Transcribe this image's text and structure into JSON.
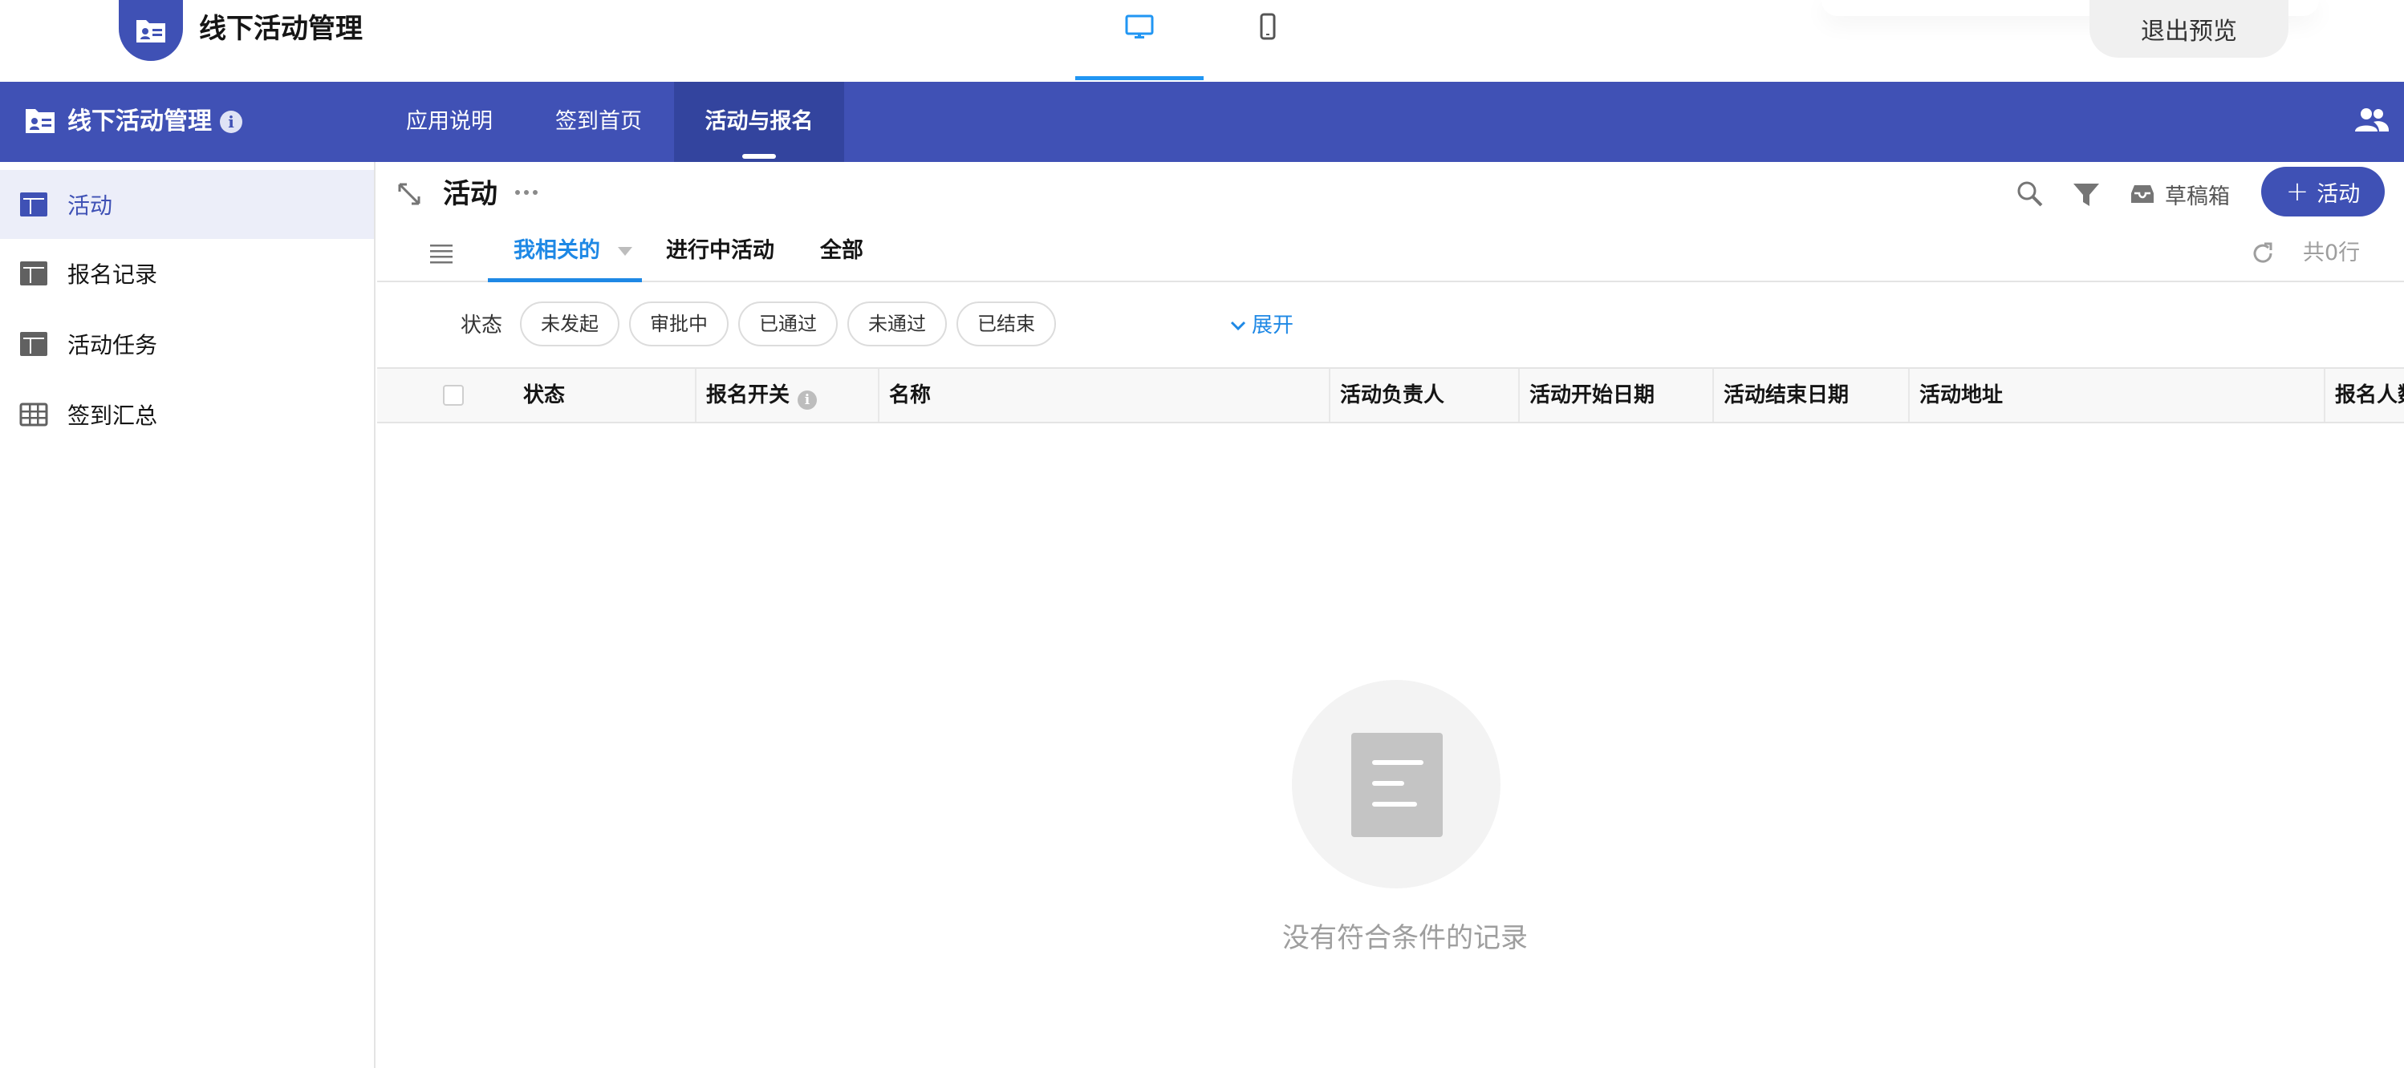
{
  "preview": {
    "app_name": "线下活动管理",
    "exit_label": "退出预览",
    "devices": [
      "desktop-icon",
      "mobile-icon"
    ],
    "active_device": "desktop"
  },
  "header": {
    "title": "线下活动管理",
    "info_glyph": "i",
    "tabs": [
      {
        "label": "应用说明",
        "active": false
      },
      {
        "label": "签到首页",
        "active": false
      },
      {
        "label": "活动与报名",
        "active": true
      }
    ],
    "accent_color": "#4051b5"
  },
  "sidebar": {
    "items": [
      {
        "label": "活动",
        "icon": "table-icon",
        "active": true
      },
      {
        "label": "报名记录",
        "icon": "table-icon",
        "active": false
      },
      {
        "label": "活动任务",
        "icon": "table-icon",
        "active": false
      },
      {
        "label": "签到汇总",
        "icon": "grid-icon",
        "active": false
      }
    ]
  },
  "main": {
    "title": "活动",
    "draft_label": "草稿箱",
    "add_label": "活动",
    "add_plus": "+",
    "view_tabs": [
      {
        "label": "我相关的",
        "active": true
      },
      {
        "label": "进行中活动",
        "active": false
      },
      {
        "label": "全部",
        "active": false
      }
    ],
    "row_count": "共0行",
    "filter": {
      "label": "状态",
      "chips": [
        "未发起",
        "审批中",
        "已通过",
        "未通过",
        "已结束"
      ],
      "expand_label": "展开"
    },
    "columns": [
      "状态",
      "报名开关",
      "名称",
      "活动负责人",
      "活动开始日期",
      "活动结束日期",
      "活动地址",
      "报名人数"
    ],
    "column_info_glyph": "i",
    "empty_text": "没有符合条件的记录"
  }
}
